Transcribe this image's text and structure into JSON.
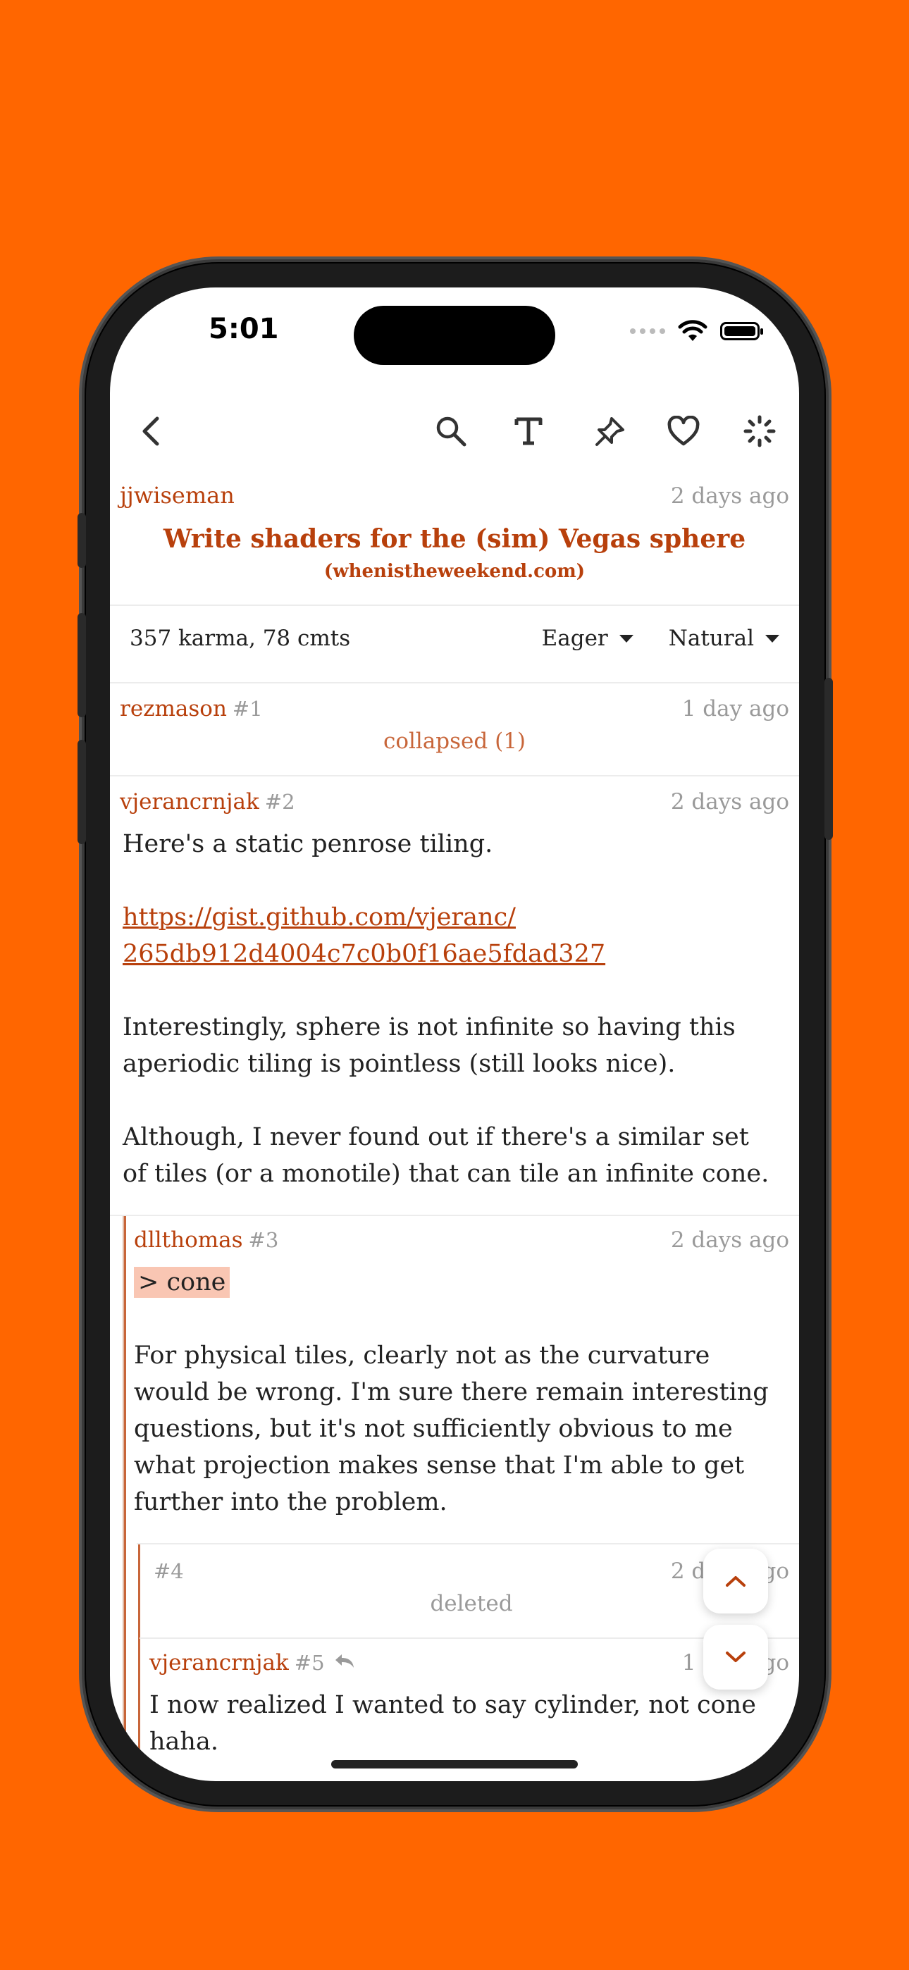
{
  "status_bar": {
    "time": "5:01"
  },
  "toolbar": {
    "back_icon": "chevron-left-icon",
    "search_icon": "search-icon",
    "text_size_icon": "text-size-icon",
    "pin_icon": "pin-icon",
    "favorite_icon": "heart-icon",
    "loading_icon": "spinner-icon"
  },
  "post": {
    "author": "jjwiseman",
    "time": "2 days ago",
    "title": "Write shaders for the (sim) Vegas sphere",
    "domain": "(whenistheweekend.com)"
  },
  "stats": {
    "summary": "357 karma, 78 cmts",
    "filter": "Eager",
    "sort": "Natural"
  },
  "comments": [
    {
      "author": "rezmason",
      "number": "#1",
      "time": "1 day ago",
      "note": "collapsed (1)"
    },
    {
      "author": "vjerancrnjak",
      "number": "#2",
      "time": "2 days ago",
      "p1": "Here's a static penrose tiling.",
      "link": "https://gist.github.com/vjeranc/ 265db912d4004c7c0b0f16ae5fdad327",
      "p3": "Interestingly, sphere is not infinite so having this aperiodic tiling is pointless (still looks nice).",
      "p4": "Although, I never found out if there's a similar set of tiles (or a monotile) that can tile an infinite cone."
    },
    {
      "author": "dllthomas",
      "number": "#3",
      "time": "2 days ago",
      "quote": "> cone",
      "p1": "For physical tiles, clearly not as the curvature would be wrong.  I'm sure there remain interesting questions, but it's not sufficiently obvious to me what projection makes sense that I'm able to get further into the problem."
    },
    {
      "number": "#4",
      "time": "2 days ago",
      "note": "deleted"
    },
    {
      "author": "vjerancrnjak",
      "number": "#5",
      "time": "1 day ago",
      "p1": "I now realized I wanted to say cylinder, not cone haha."
    }
  ],
  "colors": {
    "background": "#ff6600",
    "accent": "#b8400c",
    "muted": "#9a9a9a",
    "quote_bg": "#f9c6b3"
  }
}
